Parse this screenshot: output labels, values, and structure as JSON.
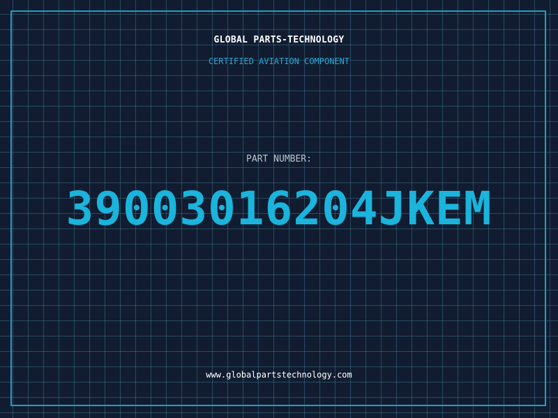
{
  "header": {
    "company_name": "GLOBAL PARTS-TECHNOLOGY",
    "tagline": "CERTIFIED AVIATION COMPONENT"
  },
  "part": {
    "label": "PART NUMBER:",
    "number": "3900301620 4JKEM"
  },
  "footer": {
    "website": "www.globalpartstechnology.com"
  },
  "colors": {
    "background": "#111c30",
    "grid": "#3f7f93",
    "frame": "#1ea0c8",
    "accent": "#1ab4dc",
    "tagline": "#2aa6d6",
    "label": "#b9c3cf",
    "text": "#ffffff"
  }
}
